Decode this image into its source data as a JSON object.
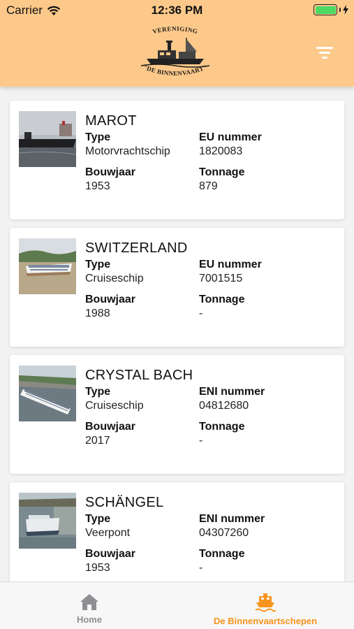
{
  "status_bar": {
    "carrier": "Carrier",
    "time": "12:36 PM"
  },
  "header": {
    "background_color": "#fdc98a",
    "logo": {
      "top_text": "VERENIGING",
      "bottom_text": "\"DE BINNENVAART\""
    },
    "filter_icon": "filter-icon"
  },
  "ships": [
    {
      "name": "MAROT",
      "type_label": "Type",
      "type": "Motorvrachtschip",
      "number_label": "EU nummer",
      "number": "1820083",
      "year_label": "Bouwjaar",
      "year": "1953",
      "tonnage_label": "Tonnage",
      "tonnage": "879"
    },
    {
      "name": "SWITZERLAND",
      "type_label": "Type",
      "type": "Cruiseschip",
      "number_label": "EU nummer",
      "number": "7001515",
      "year_label": "Bouwjaar",
      "year": "1988",
      "tonnage_label": "Tonnage",
      "tonnage": "-"
    },
    {
      "name": "CRYSTAL BACH",
      "type_label": "Type",
      "type": "Cruiseschip",
      "number_label": "ENI nummer",
      "number": "04812680",
      "year_label": "Bouwjaar",
      "year": "2017",
      "tonnage_label": "Tonnage",
      "tonnage": "-"
    },
    {
      "name": "SCHÄNGEL",
      "type_label": "Type",
      "type": "Veerpont",
      "number_label": "ENI nummer",
      "number": "04307260",
      "year_label": "Bouwjaar",
      "year": "1953",
      "tonnage_label": "Tonnage",
      "tonnage": "-"
    }
  ],
  "tabbar": {
    "home_label": "Home",
    "home_icon": "home-icon",
    "ships_label": "De Binnenvaartschepen",
    "ships_icon": "ferry-icon",
    "active_color": "#f7941d",
    "inactive_color": "#8e8e93"
  }
}
